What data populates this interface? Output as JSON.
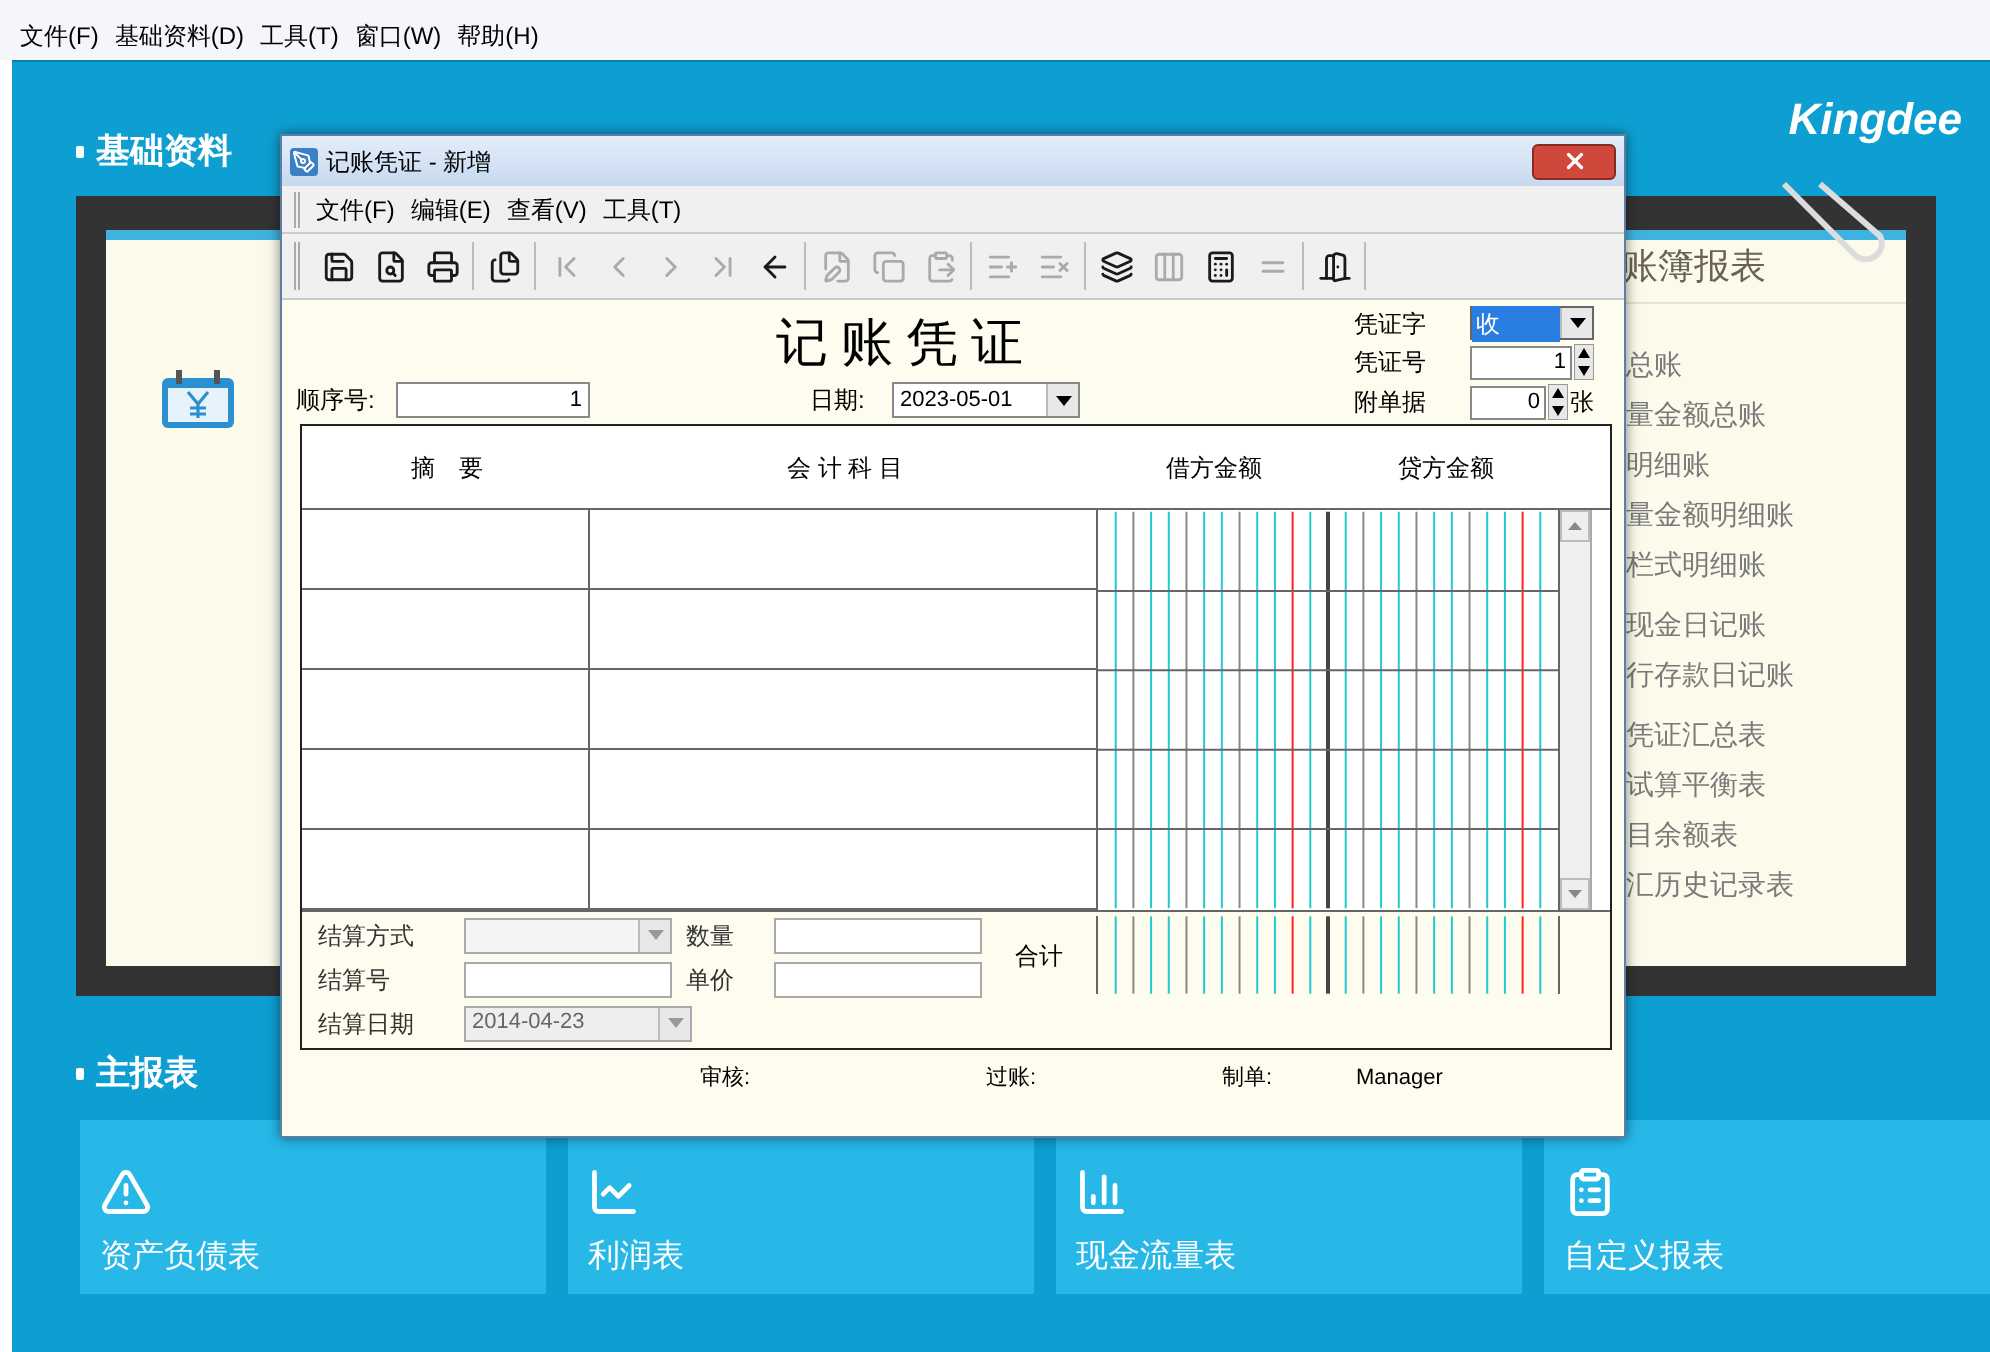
{
  "menu_bar": [
    "文件(F)",
    "基础资料(D)",
    "工具(T)",
    "窗口(W)",
    "帮助(H)"
  ],
  "section_basic": {
    "title": "基础资料"
  },
  "logo": "Kingdee",
  "ledger_panel": {
    "title": "账簿报表",
    "groups": [
      [
        "总账",
        "量金额总账",
        "明细账",
        "量金额明细账",
        "栏式明细账"
      ],
      [
        "现金日记账",
        "行存款日记账"
      ],
      [
        "凭证汇总表",
        "试算平衡表",
        "目余额表",
        "汇历史记录表"
      ]
    ]
  },
  "section_main": {
    "title": "主报表"
  },
  "report_tiles": [
    {
      "label": "资产负债表",
      "kind": "warning"
    },
    {
      "label": "利润表",
      "kind": "line"
    },
    {
      "label": "现金流量表",
      "kind": "bar"
    },
    {
      "label": "自定义报表",
      "kind": "clipboard"
    }
  ],
  "dialog": {
    "title": "记账凭证 - 新增",
    "menu": [
      "文件(F)",
      "编辑(E)",
      "查看(V)",
      "工具(T)"
    ],
    "toolbar": [
      [
        {
          "kind": "save",
          "disabled": false
        },
        {
          "kind": "preview",
          "disabled": false
        },
        {
          "kind": "print",
          "disabled": false
        }
      ],
      [
        {
          "kind": "stack",
          "disabled": false
        }
      ],
      [
        {
          "kind": "first",
          "disabled": true
        },
        {
          "kind": "prev",
          "disabled": true
        },
        {
          "kind": "next",
          "disabled": true
        },
        {
          "kind": "last",
          "disabled": true
        },
        {
          "kind": "back",
          "disabled": false
        }
      ],
      [
        {
          "kind": "edit",
          "disabled": true
        },
        {
          "kind": "copy",
          "disabled": true
        },
        {
          "kind": "paste",
          "disabled": true
        }
      ],
      [
        {
          "kind": "insert",
          "disabled": true
        },
        {
          "kind": "delete",
          "disabled": true
        }
      ],
      [
        {
          "kind": "layers",
          "disabled": false
        },
        {
          "kind": "columns",
          "disabled": true
        },
        {
          "kind": "calculator",
          "disabled": false
        },
        {
          "kind": "equal",
          "disabled": true
        }
      ],
      [
        {
          "kind": "exit",
          "disabled": false
        }
      ]
    ],
    "voucher_title": "记 账 凭 证",
    "sequence": {
      "label": "顺序号:",
      "value": "1"
    },
    "date": {
      "label": "日期:",
      "value": "2023-05-01"
    },
    "voucher_type": {
      "label": "凭证字",
      "value": "收",
      "focused": true
    },
    "voucher_no": {
      "label": "凭证号",
      "value": "1"
    },
    "attachments": {
      "label": "附单据",
      "value": "0",
      "unit": "张"
    },
    "columns": [
      "摘　要",
      "会 计 科 目",
      "借方金额",
      "贷方金额"
    ],
    "settlement_method": {
      "label": "结算方式",
      "disabled": true
    },
    "settlement_no": {
      "label": "结算号"
    },
    "settlement_date": {
      "label": "结算日期",
      "value": "2014-04-23",
      "disabled": true
    },
    "quantity": {
      "label": "数量"
    },
    "unit_price": {
      "label": "单价"
    },
    "total_label": "合计",
    "footer": {
      "review": "审核:",
      "post": "过账:",
      "maker": "制单:",
      "maker_value": "Manager"
    }
  }
}
